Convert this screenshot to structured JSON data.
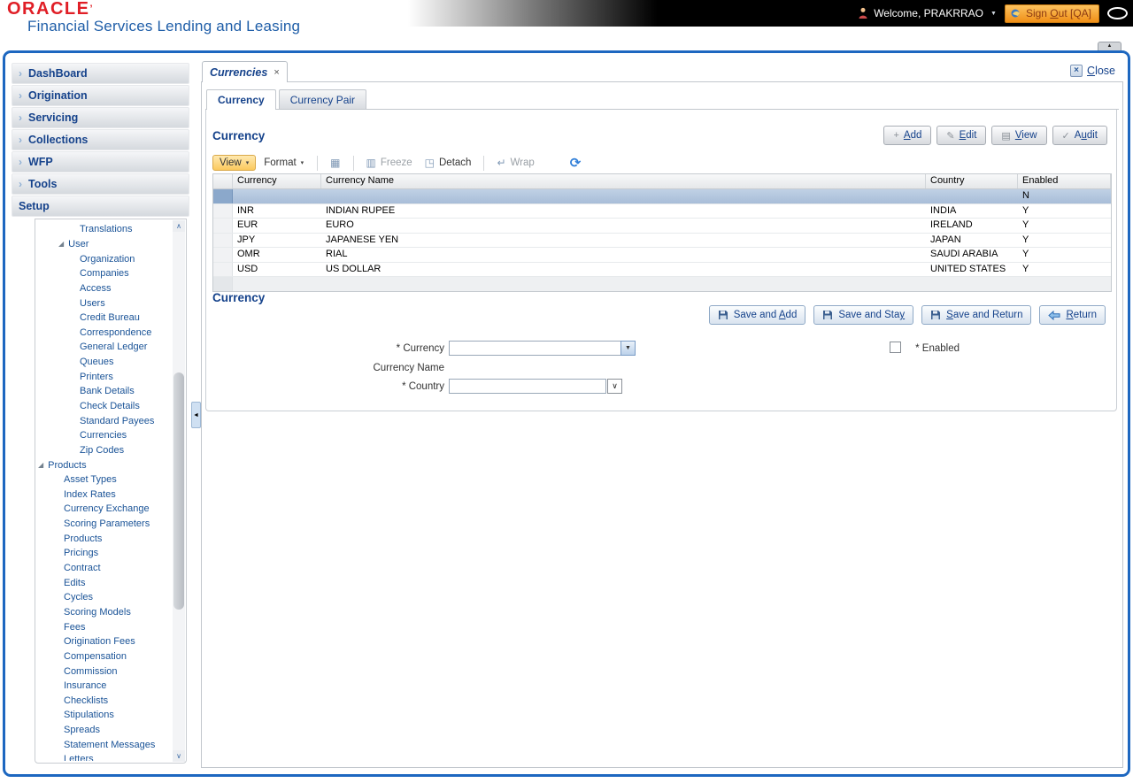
{
  "header": {
    "logo": "ORACLE",
    "logo_mark": "’",
    "subtitle": "Financial Services Lending and Leasing",
    "welcome": "Welcome, PRAKRRAO",
    "sign_out": {
      "pre": "Sign ",
      "u": "O",
      "rest": "ut [QA]"
    }
  },
  "colors": {
    "frame_blue": "#1d67c0",
    "navy_text": "#15428b",
    "oracle_red": "#e01e26",
    "signout_orange": "#f08f17",
    "selected_row_blue": "#a8bdd8",
    "toolbar_highlight_orange": "#fbc95d"
  },
  "glyphs": {
    "accordion_chevron": "›",
    "tree_twisty": "◢",
    "menu_caret": "▾",
    "dropdown_caret": "▼",
    "select_chevron": "∨",
    "scroll_up": "∧",
    "scroll_down": "∨",
    "splitter_collapse": "◄",
    "panel_collapse": "▲",
    "tab_close": "×",
    "close_x": "×",
    "welcome_caret": "▼",
    "plus": "+",
    "pencil": "✎",
    "view_doc": "▤",
    "check": "✓",
    "qbe_grid": "▦",
    "freeze_grid": "▥",
    "detach_win": "◳",
    "wrap_arrow": "↵",
    "refresh": "⟳"
  },
  "sidebar": {
    "accordion": [
      {
        "label": "DashBoard"
      },
      {
        "label": "Origination"
      },
      {
        "label": "Servicing"
      },
      {
        "label": "Collections"
      },
      {
        "label": "WFP"
      },
      {
        "label": "Tools"
      },
      {
        "label": "Setup"
      }
    ],
    "tree": [
      {
        "label": "Translations"
      },
      {
        "label": "User"
      },
      {
        "label": "Organization"
      },
      {
        "label": "Companies"
      },
      {
        "label": "Access"
      },
      {
        "label": "Users"
      },
      {
        "label": "Credit Bureau"
      },
      {
        "label": "Correspondence"
      },
      {
        "label": "General Ledger"
      },
      {
        "label": "Queues"
      },
      {
        "label": "Printers"
      },
      {
        "label": "Bank Details"
      },
      {
        "label": "Check Details"
      },
      {
        "label": "Standard Payees"
      },
      {
        "label": "Currencies"
      },
      {
        "label": "Zip Codes"
      },
      {
        "label": "Products"
      },
      {
        "label": "Asset Types"
      },
      {
        "label": "Index Rates"
      },
      {
        "label": "Currency Exchange"
      },
      {
        "label": "Scoring Parameters"
      },
      {
        "label": "Products"
      },
      {
        "label": "Pricings"
      },
      {
        "label": "Contract"
      },
      {
        "label": "Edits"
      },
      {
        "label": "Cycles"
      },
      {
        "label": "Scoring Models"
      },
      {
        "label": "Fees"
      },
      {
        "label": "Origination Fees"
      },
      {
        "label": "Compensation"
      },
      {
        "label": "Commission"
      },
      {
        "label": "Insurance"
      },
      {
        "label": "Checklists"
      },
      {
        "label": "Stipulations"
      },
      {
        "label": "Spreads"
      },
      {
        "label": "Statement Messages"
      },
      {
        "label": "Letters"
      }
    ]
  },
  "main": {
    "doc_tab": {
      "label": "Currencies"
    },
    "close": {
      "u": "C",
      "rest": "lose"
    },
    "subtabs": {
      "currency": "Currency",
      "currency_pair": "Currency Pair"
    },
    "grid": {
      "title": "Currency",
      "actions": {
        "add": {
          "pre": "",
          "u": "A",
          "rest": "dd"
        },
        "edit": {
          "pre": "",
          "u": "E",
          "rest": "dit"
        },
        "view": {
          "pre": "",
          "u": "V",
          "rest": "iew"
        },
        "audit": {
          "pre": "A",
          "u": "u",
          "rest": "dit"
        }
      },
      "toolbar": {
        "view": "View",
        "format": "Format",
        "freeze": "Freeze",
        "detach": "Detach",
        "wrap": "Wrap"
      },
      "columns": {
        "currency": "Currency",
        "currency_name": "Currency Name",
        "country": "Country",
        "enabled": "Enabled"
      },
      "selected_row": {
        "currency": "",
        "currency_name": "",
        "country": "",
        "enabled": "N"
      },
      "rows": [
        {
          "currency": "INR",
          "currency_name": "INDIAN RUPEE",
          "country": "INDIA",
          "enabled": "Y"
        },
        {
          "currency": "EUR",
          "currency_name": "EURO",
          "country": "IRELAND",
          "enabled": "Y"
        },
        {
          "currency": "JPY",
          "currency_name": "JAPANESE YEN",
          "country": "JAPAN",
          "enabled": "Y"
        },
        {
          "currency": "OMR",
          "currency_name": "RIAL",
          "country": "SAUDI ARABIA",
          "enabled": "Y"
        },
        {
          "currency": "USD",
          "currency_name": "US DOLLAR",
          "country": "UNITED STATES",
          "enabled": "Y"
        }
      ]
    },
    "form": {
      "title": "Currency",
      "buttons": {
        "save_add": {
          "pre": "Save and ",
          "u": "A",
          "rest": "dd"
        },
        "save_stay": {
          "pre": "Save and Sta",
          "u": "y",
          "rest": ""
        },
        "save_return": {
          "pre": "",
          "u": "S",
          "rest": "ave and Return"
        },
        "return": {
          "pre": "",
          "u": "R",
          "rest": "eturn"
        }
      },
      "labels": {
        "currency": "* Currency",
        "currency_name": "Currency Name",
        "country": "* Country",
        "enabled": "* Enabled"
      }
    }
  }
}
